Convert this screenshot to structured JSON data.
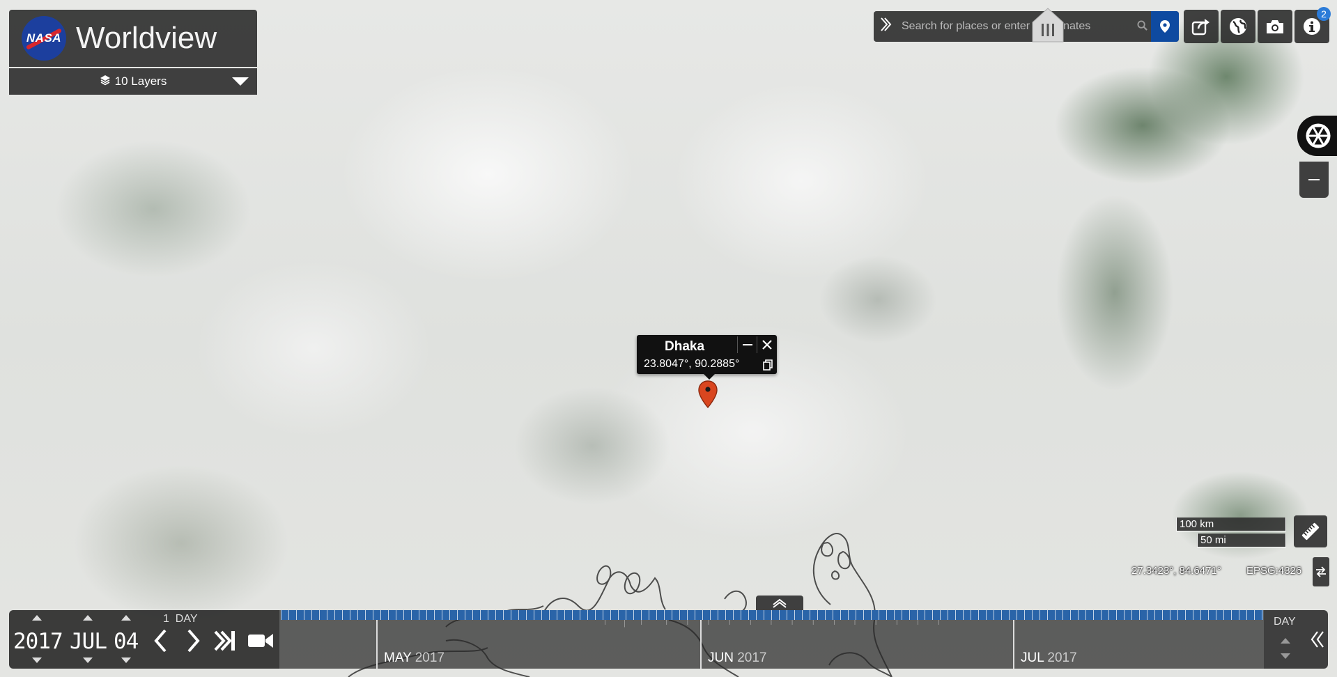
{
  "header": {
    "logo_text": "NASA",
    "app_title": "Worldview",
    "layers_label": "10 Layers"
  },
  "toolbar": {
    "search_placeholder": "Search for places or enter coordinates",
    "info_badge": "2"
  },
  "popup": {
    "place_name": "Dhaka",
    "coordinates": "23.8047°, 90.2885°"
  },
  "scale": {
    "km_label": "100 km",
    "mi_label": "50 mi"
  },
  "readout": {
    "coordinates": "27.3423°, 84.6471°",
    "projection": "EPSG:4326"
  },
  "date": {
    "year": "2017",
    "month": "JUL",
    "day": "04",
    "interval_count": "1",
    "interval_unit": "DAY"
  },
  "timeline": {
    "zoom_level": "DAY",
    "months": [
      {
        "name": "MAY",
        "year": "2017"
      },
      {
        "name": "JUN",
        "year": "2017"
      },
      {
        "name": "JUL",
        "year": "2017"
      }
    ]
  },
  "colors": {
    "accent_blue": "#0e4aa0",
    "timeline_blue": "#2a64a8",
    "marker_red": "#d9461f",
    "badge_blue": "#2b7bd8"
  }
}
